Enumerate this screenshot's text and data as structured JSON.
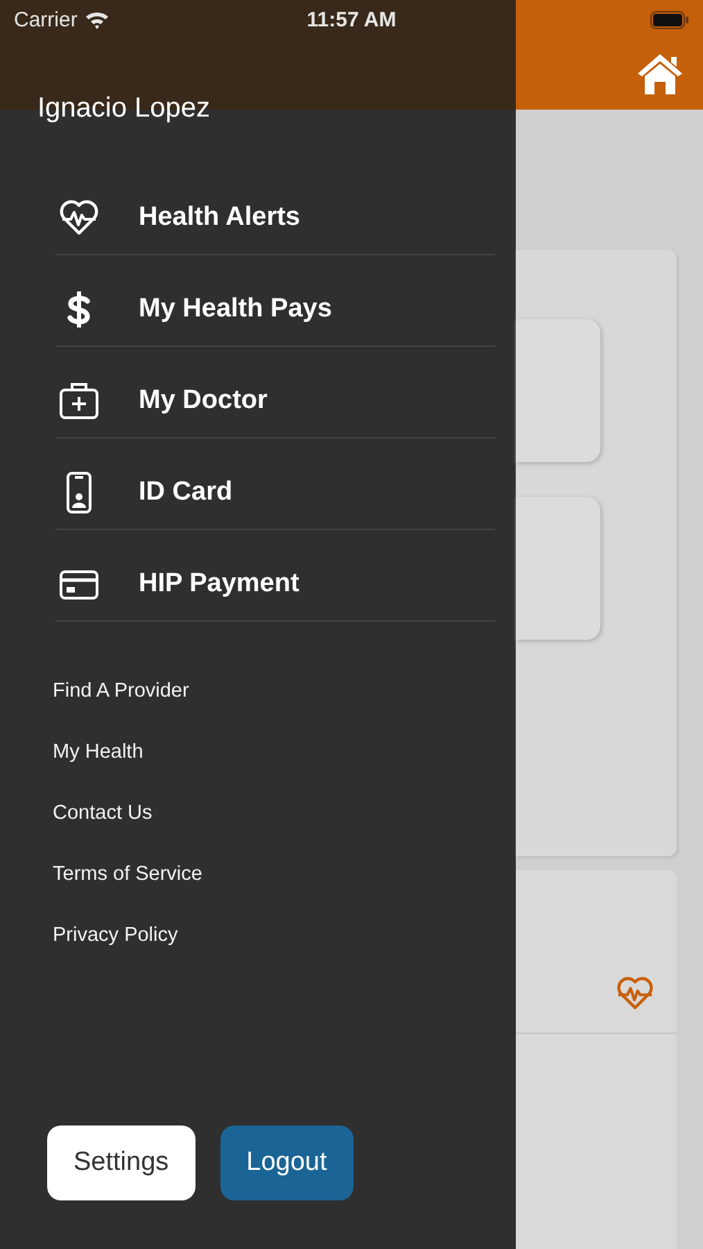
{
  "status_bar": {
    "carrier": "Carrier",
    "time": "11:57 AM"
  },
  "drawer": {
    "user_name": "Ignacio Lopez",
    "menu": [
      {
        "label": "Health Alerts"
      },
      {
        "label": "My Health Pays"
      },
      {
        "label": "My Doctor"
      },
      {
        "label": "ID Card"
      },
      {
        "label": "HIP Payment"
      }
    ],
    "links": [
      "Find A Provider",
      "My Health",
      "Contact Us",
      "Terms of Service",
      "Privacy Policy"
    ],
    "buttons": [
      {
        "label": "Settings",
        "kind": "secondary"
      },
      {
        "label": "Logout",
        "kind": "primary"
      }
    ]
  }
}
